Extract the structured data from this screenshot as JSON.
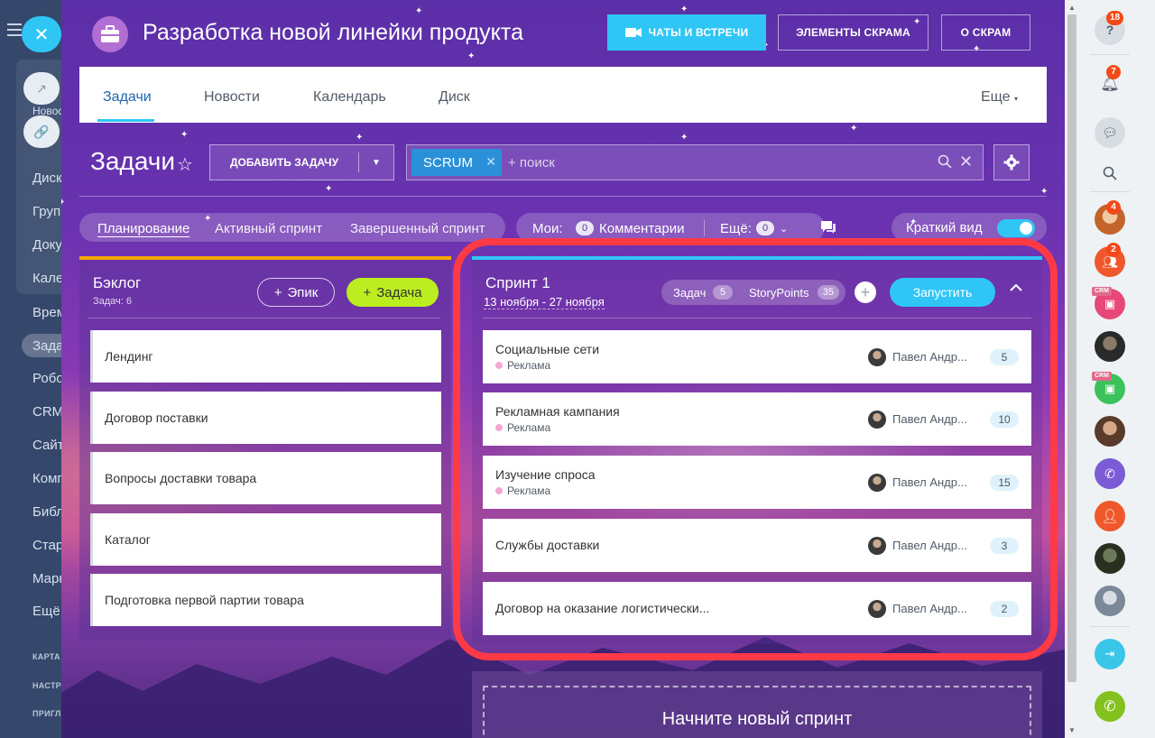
{
  "background_nav": {
    "items": [
      "Новости",
      "Диск",
      "Групп",
      "Доку",
      "Кале",
      "Врем",
      "Зада",
      "Робо",
      "CRM",
      "Сайт",
      "Комп",
      "Библ",
      "Стар",
      "Марк",
      "Ещё"
    ],
    "sections": [
      "КАРТА",
      "НАСТР",
      "ПРИГЛ"
    ]
  },
  "header": {
    "project_title": "Разработка новой линейки продукта",
    "buttons": {
      "chats": "ЧАТЫ И ВСТРЕЧИ",
      "scrum_elements": "ЭЛЕМЕНТЫ СКРАМА",
      "about_scrum": "О СКРАМ"
    }
  },
  "tabs": {
    "items": [
      "Задачи",
      "Новости",
      "Календарь",
      "Диск"
    ],
    "active": "Задачи",
    "more": "Еще"
  },
  "toolbar": {
    "title": "Задачи",
    "add_task": "ДОБАВИТЬ ЗАДАЧУ",
    "filter_chip": "SCRUM",
    "search_placeholder": "+ поиск"
  },
  "views": {
    "planning": "Планирование",
    "active_sprint": "Активный спринт",
    "completed_sprint": "Завершенный спринт",
    "my_label": "Мои:",
    "my_count": "0",
    "comments": "Комментарии",
    "more_label": "Ещё:",
    "more_count": "0",
    "compact_view": "Краткий вид",
    "compact_enabled": true
  },
  "backlog": {
    "title": "Бэклог",
    "count_label": "Задач: 6",
    "epic_button": "Эпик",
    "task_button": "Задача",
    "items": [
      "Лендинг",
      "Договор поставки",
      "Вопросы доставки товара",
      "Каталог",
      "Подготовка первой партии товара"
    ]
  },
  "sprint": {
    "title": "Спринт 1",
    "dates": "13 ноября - 27 ноября",
    "tasks_label": "Задач",
    "tasks_count": "5",
    "sp_label": "StoryPoints",
    "sp_count": "35",
    "start_button": "Запустить",
    "items": [
      {
        "title": "Социальные сети",
        "epic": "Реклама",
        "user": "Павел Андр...",
        "points": "5"
      },
      {
        "title": "Рекламная кампания",
        "epic": "Реклама",
        "user": "Павел Андр...",
        "points": "10"
      },
      {
        "title": "Изучение спроса",
        "epic": "Реклама",
        "user": "Павел Андр...",
        "points": "15"
      },
      {
        "title": "Службы доставки",
        "epic": "",
        "user": "Павел Андр...",
        "points": "3"
      },
      {
        "title": "Договор на оказание логистически...",
        "epic": "",
        "user": "Павел Андр...",
        "points": "2"
      }
    ]
  },
  "new_sprint": "Начните новый спринт",
  "right_rail": {
    "help_badge": "18",
    "notifications_badge": "7",
    "contact1_badge": "4",
    "contact2_badge": "2",
    "crm_tag": "CRM"
  },
  "colors": {
    "accent": "#2fc6f6",
    "highlight": "#ff3a45",
    "task_button": "#bbed21",
    "backlog_top": "#f7a700",
    "badge": "#f54819"
  }
}
